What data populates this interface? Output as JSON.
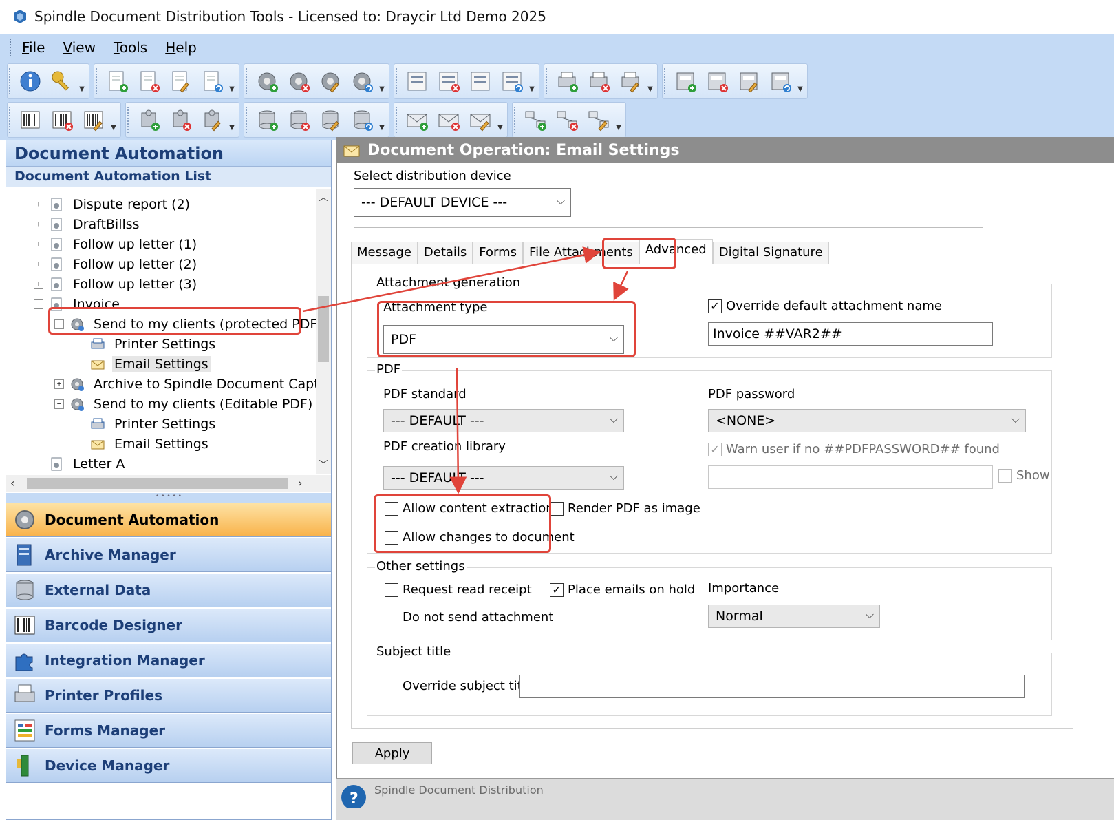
{
  "window": {
    "title": "Spindle Document Distribution Tools - Licensed to: Draycir Ltd Demo 2025"
  },
  "menu": {
    "items": [
      {
        "first": "F",
        "rest": "ile"
      },
      {
        "first": "V",
        "rest": "iew"
      },
      {
        "first": "T",
        "rest": "ools"
      },
      {
        "first": "H",
        "rest": "elp"
      }
    ]
  },
  "left": {
    "header": "Document Automation",
    "subheader": "Document Automation List",
    "tree": [
      {
        "label": "Dispute report (2)",
        "expander": "+",
        "level": 0
      },
      {
        "label": "DraftBillss",
        "expander": "+",
        "level": 0
      },
      {
        "label": "Follow up letter (1)",
        "expander": "+",
        "level": 0
      },
      {
        "label": "Follow up letter (2)",
        "expander": "+",
        "level": 0
      },
      {
        "label": "Follow up letter (3)",
        "expander": "+",
        "level": 0
      },
      {
        "label": "Invoice",
        "expander": "−",
        "level": 0
      },
      {
        "label": "Send to my clients (protected PDF)",
        "expander": "−",
        "level": 1
      },
      {
        "label": "Printer Settings",
        "expander": "",
        "level": 2
      },
      {
        "label": "Email Settings",
        "expander": "",
        "level": 2
      },
      {
        "label": "Archive to Spindle Document Captur",
        "expander": "+",
        "level": 1
      },
      {
        "label": "Send to my clients (Editable PDF)",
        "expander": "−",
        "level": 1
      },
      {
        "label": "Printer Settings",
        "expander": "",
        "level": 2
      },
      {
        "label": "Email Settings",
        "expander": "",
        "level": 2
      },
      {
        "label": "Letter A",
        "expander": "",
        "level": 0
      }
    ],
    "nav": [
      {
        "label": "Document Automation",
        "icon": "gear-icon"
      },
      {
        "label": "Archive Manager",
        "icon": "archive-icon"
      },
      {
        "label": "External Data",
        "icon": "database-icon"
      },
      {
        "label": "Barcode Designer",
        "icon": "barcode-icon"
      },
      {
        "label": "Integration Manager",
        "icon": "puzzle-icon"
      },
      {
        "label": "Printer Profiles",
        "icon": "printer-icon"
      },
      {
        "label": "Forms Manager",
        "icon": "form-icon"
      },
      {
        "label": "Device Manager",
        "icon": "device-icon"
      }
    ]
  },
  "panel": {
    "header": "Document Operation: Email Settings",
    "device_label": "Select distribution device",
    "device_value": "--- DEFAULT DEVICE ---",
    "tabs": [
      "Message",
      "Details",
      "Forms",
      "File Attachments",
      "Advanced",
      "Digital Signature"
    ],
    "active_tab": "Advanced",
    "attach_group": "Attachment generation",
    "attach_type_label": "Attachment type",
    "attach_type_value": "PDF",
    "override_name_label": "Override default attachment name",
    "override_name_value": "Invoice ##VAR2##",
    "pdf_group": "PDF",
    "pdf_standard_label": "PDF standard",
    "pdf_standard_value": "--- DEFAULT ---",
    "pdf_library_label": "PDF creation library",
    "pdf_library_value": "--- DEFAULT ---",
    "pdf_password_label": "PDF password",
    "pdf_password_value": "<NONE>",
    "warn_label": "Warn user if no ##PDFPASSWORD## found",
    "password_value": "",
    "show_label": "Show",
    "allow_extraction_label": "Allow content extraction",
    "allow_changes_label": "Allow changes to document",
    "render_image_label": "Render PDF as image",
    "other_group": "Other settings",
    "read_receipt_label": "Request read receipt",
    "hold_label": "Place emails on hold",
    "no_attach_label": "Do not send attachment",
    "importance_label": "Importance",
    "importance_value": "Normal",
    "subject_group": "Subject title",
    "override_subject_label": "Override subject title",
    "subject_value": "",
    "apply_label": "Apply"
  },
  "status": {
    "text": "Spindle Document Distribution"
  },
  "colors": {
    "accent_red": "#e0443a",
    "nav_active": "#f9b24a",
    "header_blue": "#1d3f78"
  }
}
